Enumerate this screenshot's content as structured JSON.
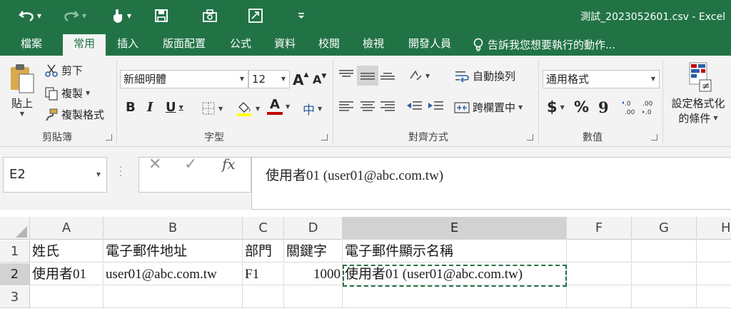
{
  "window": {
    "title": "測試_2023052601.csv - Excel"
  },
  "quick_access": {
    "icons": [
      "undo-icon",
      "redo-icon",
      "touch-mode-icon",
      "save-icon",
      "camera-icon",
      "sheet-refresh-icon",
      "customize-qat-icon"
    ]
  },
  "tabs": [
    {
      "label": "檔案",
      "active": false
    },
    {
      "label": "常用",
      "active": true
    },
    {
      "label": "插入",
      "active": false
    },
    {
      "label": "版面配置",
      "active": false
    },
    {
      "label": "公式",
      "active": false
    },
    {
      "label": "資料",
      "active": false
    },
    {
      "label": "校閱",
      "active": false
    },
    {
      "label": "檢視",
      "active": false
    },
    {
      "label": "開發人員",
      "active": false
    }
  ],
  "tell_me": {
    "placeholder": "告訴我您想要執行的動作..."
  },
  "ribbon": {
    "clipboard": {
      "paste": "貼上",
      "cut": "剪下",
      "copy": "複製",
      "format_painter": "複製格式",
      "label": "剪貼簿"
    },
    "font": {
      "name": "新細明體",
      "size": "12",
      "grow": "A",
      "shrink": "A",
      "bold": "B",
      "italic": "I",
      "underline": "U",
      "font_color_letter": "A",
      "phonetic": "中",
      "label": "字型"
    },
    "alignment": {
      "wrap_text": "自動換列",
      "merge_center": "跨欄置中",
      "label": "對齊方式"
    },
    "number": {
      "format": "通用格式",
      "currency": "$",
      "percent": "%",
      "comma": "9",
      "inc_decimal": ".0→.00",
      "dec_decimal": ".00→.0",
      "label": "數值"
    },
    "styles": {
      "conditional_format_line1": "設定格式化",
      "conditional_format_line2": "的條件"
    }
  },
  "formula_bar": {
    "name_box": "E2",
    "cancel": "✕",
    "enter": "✓",
    "fx": "fx",
    "content": "使用者01 (user01@abc.com.tw)"
  },
  "sheet": {
    "columns": [
      "A",
      "B",
      "C",
      "D",
      "E",
      "F",
      "G",
      "H"
    ],
    "rows": [
      "1",
      "2",
      "3"
    ],
    "cells": {
      "A1": "姓氏",
      "B1": "電子郵件地址",
      "C1": "部門",
      "D1": "關鍵字",
      "E1": "電子郵件顯示名稱",
      "A2": "使用者01",
      "B2": "user01@abc.com.tw",
      "C2": "F1",
      "D2": "1000",
      "E2": "使用者01 (user01@abc.com.tw)"
    },
    "selected_cell": "E2"
  },
  "colors": {
    "accent": "#217346",
    "ribbon_bg": "#f3f3f3",
    "font_color": "#c00000",
    "highlight": "#ffff00"
  }
}
